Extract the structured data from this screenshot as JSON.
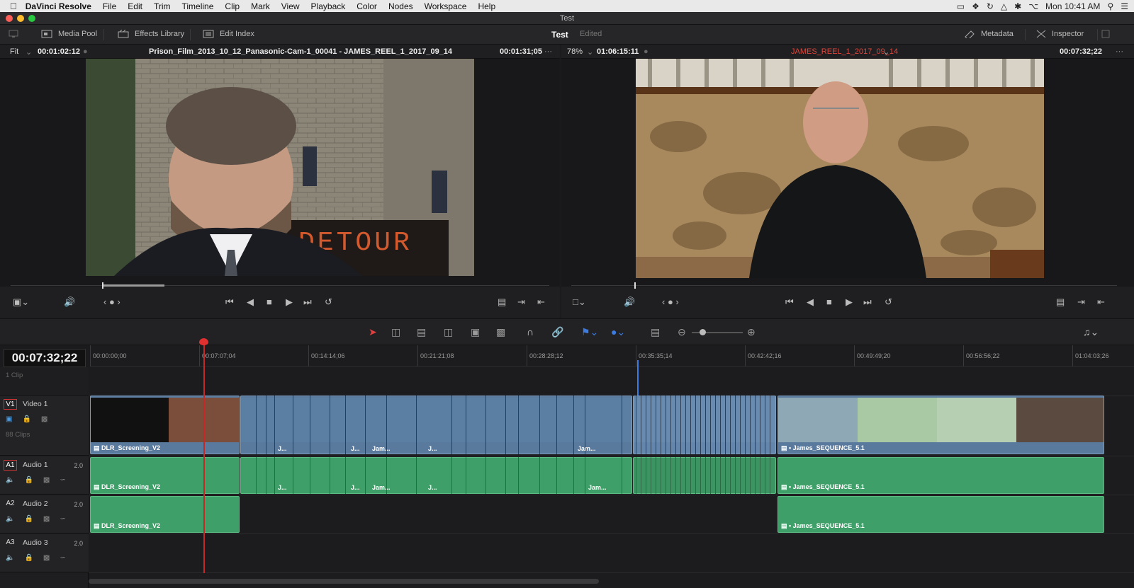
{
  "menubar": {
    "apple": "",
    "app_name": "DaVinci Resolve",
    "items": [
      "File",
      "Edit",
      "Trim",
      "Timeline",
      "Clip",
      "Mark",
      "View",
      "Playback",
      "Color",
      "Nodes",
      "Workspace",
      "Help"
    ],
    "clock": "Mon 10:41 AM"
  },
  "window": {
    "title": "Test"
  },
  "toolbar": {
    "media_pool": "Media Pool",
    "effects_library": "Effects Library",
    "edit_index": "Edit Index",
    "project": "Test",
    "status": "Edited",
    "metadata": "Metadata",
    "inspector": "Inspector"
  },
  "source_viewer": {
    "zoom": "Fit",
    "duration": "00:01:02:12",
    "clip_name": "Prison_Film_2013_10_12_Panasonic-Cam-1_00041 - JAMES_REEL_1_2017_09_14",
    "timecode": "00:01:31;05",
    "scrub_progress": 0.23
  },
  "timeline_viewer": {
    "zoom": "78%",
    "duration": "01:06:15:11",
    "timeline_name": "JAMES_REEL_1_2017_09_14",
    "timecode": "00:07:32;22",
    "scrub_progress": 0.115
  },
  "timeline": {
    "current_timecode": "00:07:32;22",
    "ruler_labels": [
      "00:00:00;00",
      "00:07:07;04",
      "00:14:14;06",
      "00:21:21;08",
      "00:28:28;12",
      "00:35:35;14",
      "00:42:42;16",
      "00:49:49;20",
      "00:56:56;22",
      "01:04:03;26"
    ],
    "subtitle_track": {
      "clips": "1 Clip"
    },
    "tracks": [
      {
        "tag": "V1",
        "name": "Video 1",
        "clips": "88 Clips",
        "channels": ""
      },
      {
        "tag": "A1",
        "name": "Audio 1",
        "channels": "2.0"
      },
      {
        "tag": "A2",
        "name": "Audio 2",
        "channels": "2.0"
      },
      {
        "tag": "A3",
        "name": "Audio 3",
        "channels": "2.0"
      }
    ],
    "clip_labels": {
      "dlr": "DLR_Screening_V2",
      "j": "J...",
      "jam": "Jam...",
      "james_seq": "James_SEQUENCE_5.1"
    }
  },
  "colors": {
    "video_clip": "#5a7a9d",
    "audio_clip": "#3f9f68",
    "playhead": "#c62828",
    "timeline_name": "#e0463c"
  }
}
